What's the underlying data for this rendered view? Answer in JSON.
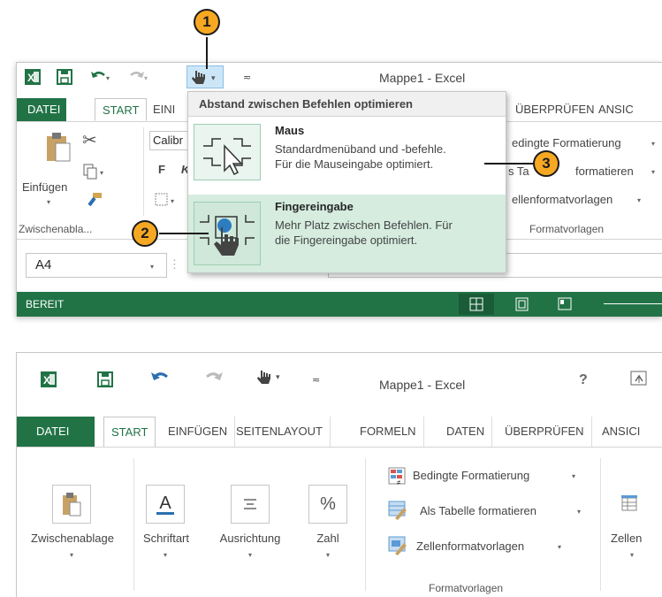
{
  "colors": {
    "excel_green": "#217346",
    "callout_fill": "#f7a823",
    "hover_green": "#d5ecdf"
  },
  "callouts": [
    "1",
    "2",
    "3"
  ],
  "window1": {
    "title": "Mappe1 - Excel",
    "tabs": {
      "file": "DATEI",
      "start": "START",
      "insert": "EINI",
      "review": "ÜBERPRÜFEN",
      "view": "ANSIC"
    },
    "clipboard": {
      "paste": "Einfügen",
      "group": "Zwischenabla..."
    },
    "font": {
      "name": "Calibr",
      "bold": "F",
      "italic": "K"
    },
    "styles": {
      "conditional": "edingte Formatierung",
      "as_table_a": "s Ta",
      "as_table_b": "formatieren",
      "cell_styles": "ellenformatvorlagen",
      "group": "Formatvorlagen"
    },
    "name_box": "A4",
    "status": "BEREIT"
  },
  "dropdown": {
    "header": "Abstand zwischen Befehlen optimieren",
    "items": [
      {
        "title": "Maus",
        "desc1": "Standardmenüband und -befehle.",
        "desc2": "Für die Mauseingabe optimiert.",
        "icon": "mouse-mode-icon"
      },
      {
        "title": "Fingereingabe",
        "desc1": "Mehr Platz zwischen Befehlen. Für",
        "desc2": "die Fingereingabe optimiert.",
        "icon": "touch-mode-icon"
      }
    ]
  },
  "window2": {
    "title": "Mappe1 - Excel",
    "help": "?",
    "tabs": [
      "DATEI",
      "START",
      "EINFÜGEN",
      "SEITENLAYOUT",
      "FORMELN",
      "DATEN",
      "ÜBERPRÜFEN",
      "ANSICI"
    ],
    "groups": {
      "clipboard": "Zwischenablage",
      "font": "Schriftart",
      "alignment": "Ausrichtung",
      "number": "Zahl",
      "cells": "Zellen",
      "styles": "Formatvorlagen"
    },
    "styles_items": [
      "Bedingte Formatierung",
      "Als Tabelle formatieren",
      "Zellenformatvorlagen"
    ],
    "number_symbol": "%",
    "font_symbol": "A"
  }
}
